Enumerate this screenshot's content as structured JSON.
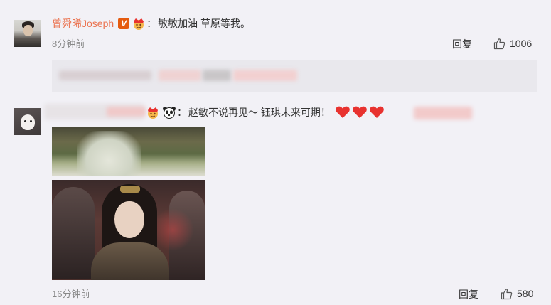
{
  "comments": [
    {
      "username": "曾舜晞Joseph",
      "badge": "V",
      "separator": "：",
      "text": "敏敏加油 草原等我。",
      "time": "8分钟前",
      "reply_label": "回复",
      "like_count": "1006",
      "icons": [
        "verified-v-icon",
        "crown-icon",
        "thumbs-up-icon"
      ]
    },
    {
      "username": "",
      "separator": "：",
      "text": "赵敏不说再见～ 钰琪未来可期！",
      "time": "16分钟前",
      "reply_label": "回复",
      "like_count": "580",
      "icons": [
        "crown-icon",
        "panda-icon",
        "heart-icon",
        "thumbs-up-icon"
      ]
    }
  ],
  "colors": {
    "background": "#f2f1f6",
    "username": "#eb7350",
    "badge": "#e55b0f",
    "heart": "#e8322f",
    "muted": "#888888"
  }
}
